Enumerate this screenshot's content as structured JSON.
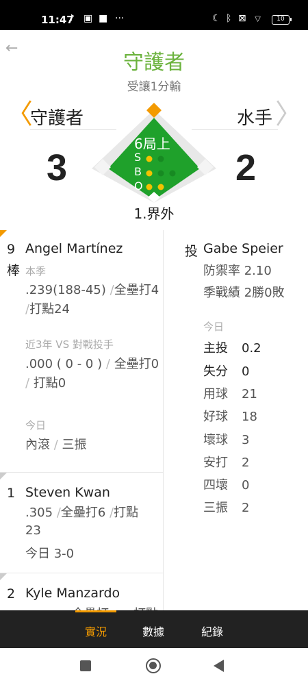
{
  "status_bar": {
    "time": "11:47",
    "left_icons": [
      "tiktok-icon",
      "sim-icon",
      "app-icon",
      "more-icon"
    ],
    "right_icons": [
      "moon-icon",
      "bluetooth-icon",
      "mobile-data-off-icon",
      "wifi-icon"
    ],
    "battery": "10"
  },
  "header": {
    "leader": "守護者",
    "result": "受讓1分輸"
  },
  "scoreboard": {
    "away_team": "守護者",
    "home_team": "水手",
    "away_score": "3",
    "home_score": "2",
    "inning": "6局上",
    "balls_strikes_outs": {
      "s_label": "S",
      "b_label": "B",
      "o_label": "O",
      "strikes": 1,
      "balls": 1,
      "outs": 2
    },
    "play_text": "1.界外",
    "colors": {
      "field": "#1fa12b",
      "accent": "#f39a00",
      "leader": "#6cb33e",
      "count_on": "#f3c200"
    }
  },
  "batters": [
    {
      "order": "9",
      "position": "棒",
      "name": "Angel Martínez",
      "season_label": "本季",
      "season_avg": ".239(188-45)",
      "season_hr": "全壘打4",
      "season_rbi": "打點24",
      "vs_label": "近3年 VS 對戰投手",
      "vs_avg": ".000 ( 0 - 0 )",
      "vs_hr": "全壘打0",
      "vs_rbi": "打點0",
      "today_label": "今日",
      "today_1": "內滾",
      "today_2": "三振"
    },
    {
      "order": "1",
      "name": "Steven Kwan",
      "avg": ".305",
      "hr": "全壘打6",
      "rbi_a": "打點",
      "rbi_b": "23",
      "today": "今日 3-0"
    },
    {
      "order": "2",
      "name": "Kyle Manzardo",
      "partial": "．　　全壘打　　打點"
    }
  ],
  "pitcher": {
    "role": "投",
    "name": "Gabe Speier",
    "era": "防禦率 2.10",
    "record": "季戰績 2勝0敗",
    "today_label": "今日",
    "stats": [
      {
        "key": "主投",
        "value": "0.2"
      },
      {
        "key": "失分",
        "value": "0"
      },
      {
        "key": "用球",
        "value": "21"
      },
      {
        "key": "好球",
        "value": "18"
      },
      {
        "key": "壞球",
        "value": "3"
      },
      {
        "key": "安打",
        "value": "2"
      },
      {
        "key": "四壞",
        "value": "0"
      },
      {
        "key": "三振",
        "value": "2"
      }
    ]
  },
  "tabs": [
    "實況",
    "數據",
    "紀錄"
  ],
  "nav_icons": [
    "recents-square-icon",
    "home-circle-icon",
    "back-triangle-icon"
  ]
}
